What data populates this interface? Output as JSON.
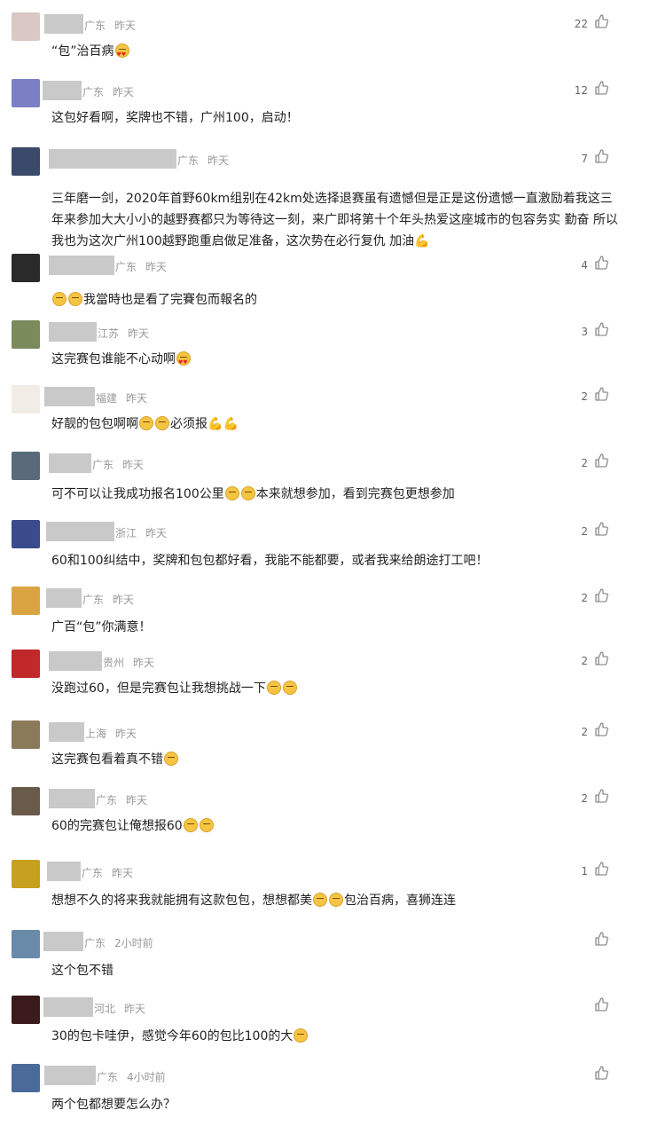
{
  "comments": [
    {
      "location": "广东",
      "time": "昨天",
      "likes": "22",
      "text": "“包”治百病",
      "emoji": [
        "heart"
      ],
      "avatar_color": "#d9c8c4"
    },
    {
      "location": "广东",
      "time": "昨天",
      "likes": "12",
      "text": "这包好看啊，奖牌也不错，广州100，启动！",
      "emoji": [],
      "avatar_color": "#7b7fc4"
    },
    {
      "location": "广东",
      "time": "昨天",
      "likes": "7",
      "text": "三年磨一剑，2020年首野60km组别在42km处选择退赛虽有遗憾但是正是这份遗憾一直激励着我这三年来参加大大小小的越野赛都只为等待这一刻，来广即将第十个年头热爱这座城市的包容务实 勤奋 所以我也为这次广州100越野跑重启做足准备，这次势在必行复仇 加油",
      "emoji": [
        "flex"
      ],
      "avatar_color": "#3a4a6a"
    },
    {
      "location": "广东",
      "time": "昨天",
      "likes": "4",
      "text": "我當時也是看了完賽包而報名的",
      "emoji_before": [
        "think",
        "think"
      ],
      "avatar_color": "#2a2a2a"
    },
    {
      "location": "江苏",
      "time": "昨天",
      "likes": "3",
      "text": "这完赛包谁能不心动啊",
      "emoji": [
        "heart"
      ],
      "avatar_color": "#7a8a5a"
    },
    {
      "location": "福建",
      "time": "昨天",
      "likes": "2",
      "text": "好靓的包包啊啊",
      "emoji_mid": [
        "grin",
        "grin"
      ],
      "text2": "必须报",
      "emoji": [
        "flex",
        "flex"
      ],
      "avatar_color": "#f2ece6"
    },
    {
      "location": "广东",
      "time": "昨天",
      "likes": "2",
      "text": "可不可以让我成功报名100公里",
      "emoji_mid": [
        "cry",
        "cry"
      ],
      "text2": "本来就想参加，看到完赛包更想参加",
      "emoji": [],
      "avatar_color": "#5a6a7a"
    },
    {
      "location": "浙江",
      "time": "昨天",
      "likes": "2",
      "text": "60和100纠结中，奖牌和包包都好看，我能不能都要，或者我来给朗途打工吧！",
      "emoji": [],
      "avatar_color": "#3a4a8a"
    },
    {
      "location": "广东",
      "time": "昨天",
      "likes": "2",
      "text": "广百“包”你满意！",
      "emoji": [],
      "avatar_color": "#d9a441"
    },
    {
      "location": "贵州",
      "time": "昨天",
      "likes": "2",
      "text": "没跑过60，但是完赛包让我想挑战一下",
      "emoji": [
        "smile",
        "smile"
      ],
      "avatar_color": "#c0282a"
    },
    {
      "location": "上海",
      "time": "昨天",
      "likes": "2",
      "text": "这完赛包看着真不错",
      "emoji": [
        "grin"
      ],
      "avatar_color": "#8a7a5a"
    },
    {
      "location": "广东",
      "time": "昨天",
      "likes": "2",
      "text": "60的完赛包让俺想报60",
      "emoji": [
        "think",
        "think"
      ],
      "avatar_color": "#6a5a4a"
    },
    {
      "location": "广东",
      "time": "昨天",
      "likes": "1",
      "text": "想想不久的将来我就能拥有这款包包，想想都美",
      "emoji_mid": [
        "grin",
        "think"
      ],
      "text2": "包治百病，喜狮连连",
      "emoji": [],
      "avatar_color": "#c8a020"
    },
    {
      "location": "广东",
      "time": "2小时前",
      "likes": "",
      "text": "这个包不错",
      "emoji": [],
      "avatar_color": "#6a8aaa"
    },
    {
      "location": "河北",
      "time": "昨天",
      "likes": "",
      "text": "30的包卡哇伊，感觉今年60的包比100的大",
      "emoji": [
        "shock"
      ],
      "avatar_color": "#3a1a1a"
    },
    {
      "location": "广东",
      "time": "4小时前",
      "likes": "",
      "text": "两个包都想要怎么办？",
      "emoji": [],
      "avatar_color": "#4a6a9a"
    }
  ]
}
